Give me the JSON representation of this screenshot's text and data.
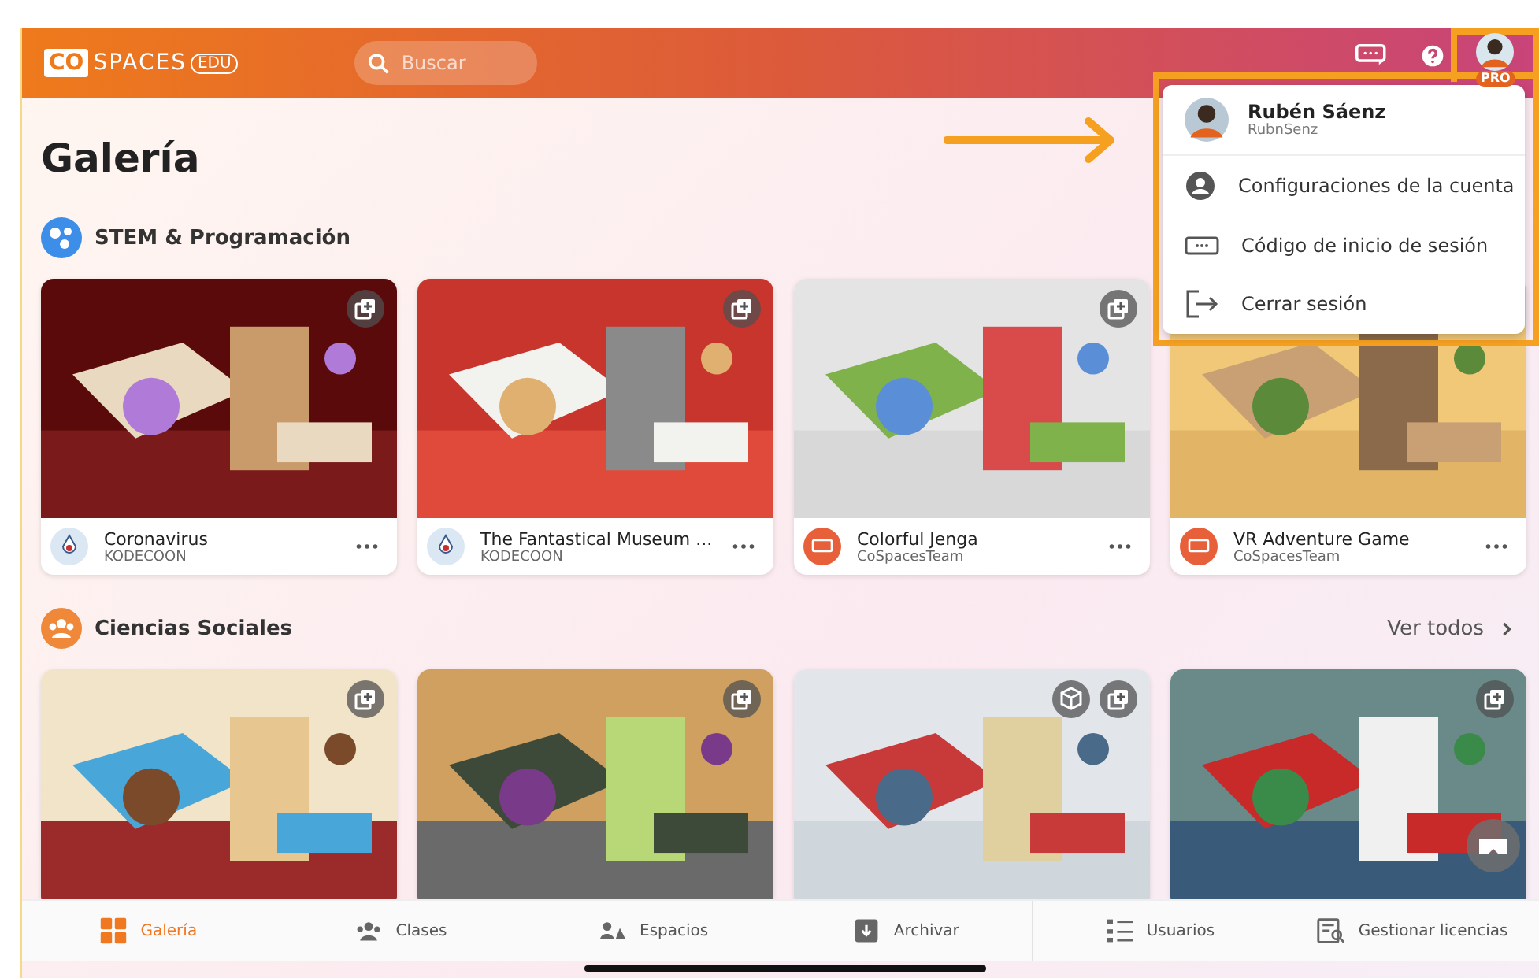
{
  "header": {
    "logo_box": "CO",
    "logo_text": "SPACES",
    "logo_badge": "EDU",
    "search": {
      "placeholder": "Buscar"
    },
    "avatar_badge": "PRO"
  },
  "page_title": "Galería",
  "sections": [
    {
      "title": "STEM & Programación",
      "cards": [
        {
          "title": "Coronavirus",
          "author": "KODECOON"
        },
        {
          "title": "The Fantastical Museum ...",
          "author": "KODECOON"
        },
        {
          "title": "Colorful Jenga",
          "author": "CoSpacesTeam"
        },
        {
          "title": "VR Adventure Game",
          "author": "CoSpacesTeam"
        }
      ]
    },
    {
      "title": "Ciencias Sociales",
      "see_all": "Ver todos"
    }
  ],
  "menu": {
    "name": "Rubén Sáenz",
    "username": "RubnSenz",
    "items": [
      {
        "label": "Configuraciones de la cuenta"
      },
      {
        "label": "Código de inicio de sesión"
      },
      {
        "label": "Cerrar sesión"
      }
    ]
  },
  "nav": [
    {
      "label": "Galería",
      "selected": true
    },
    {
      "label": "Clases",
      "selected": false
    },
    {
      "label": "Espacios",
      "selected": false
    },
    {
      "label": "Archivar",
      "selected": false
    },
    {
      "label": "Usuarios",
      "selected": false
    },
    {
      "label": "Gestionar licencias",
      "selected": false
    }
  ]
}
